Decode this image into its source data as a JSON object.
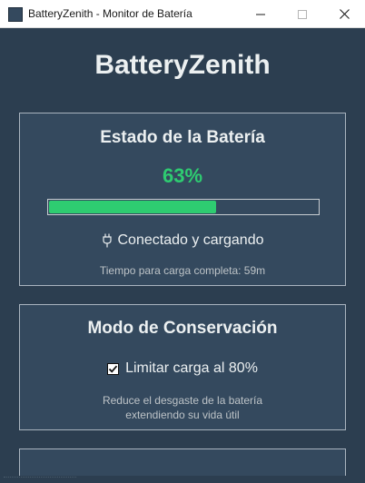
{
  "window": {
    "title": "BatteryZenith - Monitor de Batería",
    "controls": {
      "minimize": "minimize-icon",
      "maximize": "maximize-icon",
      "close": "close-icon"
    }
  },
  "app": {
    "heading": "BatteryZenith"
  },
  "status_panel": {
    "title": "Estado de la Batería",
    "percent_label": "63%",
    "percent_value": 63,
    "progress_fill_fraction": 0.62,
    "charge_icon": "plug-icon",
    "charge_state": "Conectado y cargando",
    "time_to_full": "Tiempo para carga completa: 59m"
  },
  "conservation_panel": {
    "title": "Modo de Conservación",
    "checkbox_label": "Limitar carga al 80%",
    "checkbox_checked": true,
    "description_line1": "Reduce el desgaste de la batería",
    "description_line2": "extendiendo su vida útil"
  },
  "colors": {
    "background": "#2c3e50",
    "panel": "#34495e",
    "accent_green": "#2ecc71",
    "text_light": "#ecf0f1",
    "text_muted": "#bdc3c7"
  }
}
